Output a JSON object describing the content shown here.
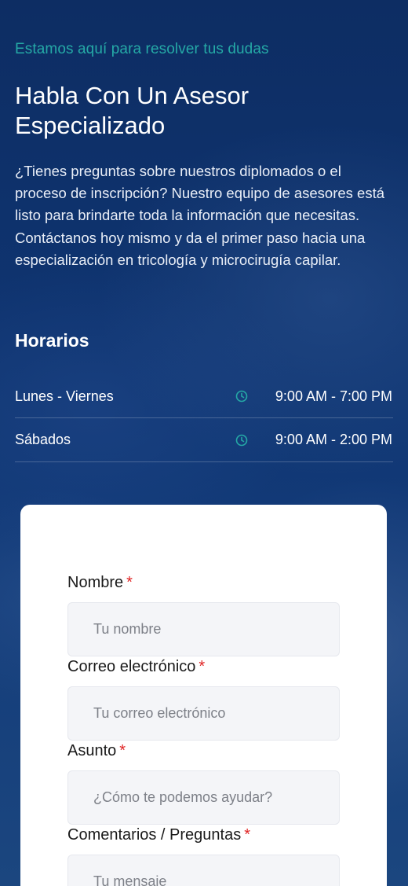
{
  "hero": {
    "eyebrow": "Estamos aquí para resolver tus dudas",
    "title": "Habla Con Un Asesor Especializado",
    "intro": "¿Tienes preguntas sobre nuestros diplomados o el proceso de inscripción? Nuestro equipo de asesores está listo para brindarte toda la información que necesitas. Contáctanos hoy mismo y da el primer paso hacia una especialización en tricología y microcirugía capilar."
  },
  "hours": {
    "title": "Horarios",
    "rows": [
      {
        "day": "Lunes - Viernes",
        "icon": "clock-icon",
        "time": "9:00 AM - 7:00 PM"
      },
      {
        "day": "Sábados",
        "icon": "clock-icon",
        "time": "9:00 AM - 2:00 PM"
      }
    ]
  },
  "form": {
    "required_mark": "*",
    "fields": [
      {
        "label": "Nombre",
        "placeholder": "Tu nombre"
      },
      {
        "label": "Correo electrónico",
        "placeholder": "Tu correo electrónico"
      },
      {
        "label": "Asunto",
        "placeholder": "¿Cómo te podemos ayudar?"
      },
      {
        "label": "Comentarios / Preguntas",
        "placeholder": "Tu mensaje"
      }
    ]
  },
  "colors": {
    "accent": "#25a9a6",
    "background": "#0f3470",
    "required": "#e02424",
    "input_bg": "#f4f5f8"
  }
}
